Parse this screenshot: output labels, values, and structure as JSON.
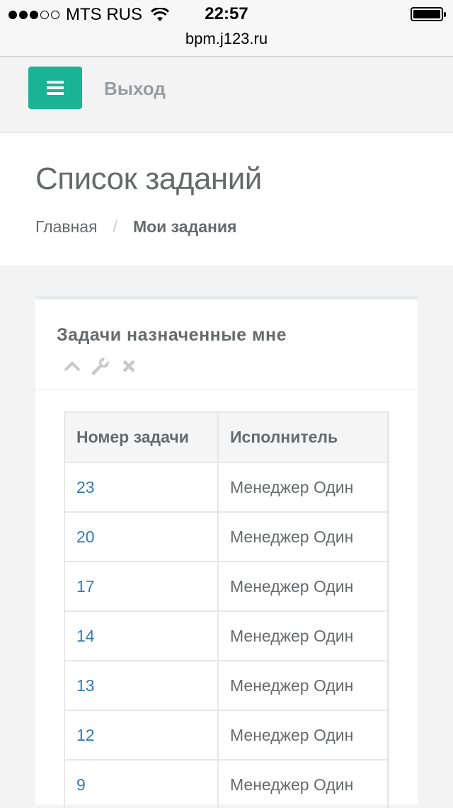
{
  "status_bar": {
    "carrier": "MTS RUS",
    "time": "22:57",
    "signal_bars_filled": 3,
    "signal_bars_total": 5,
    "battery_level": 1.0,
    "url": "bpm.j123.ru"
  },
  "navbar": {
    "menu_icon": "hamburger-icon",
    "logout_label": "Выход",
    "accent_color": "#1ab394"
  },
  "heading": {
    "title": "Список заданий",
    "breadcrumb": {
      "home": "Главная",
      "separator": "/",
      "current": "Мои задания"
    }
  },
  "ibox": {
    "title": "Задачи назначенные мне",
    "tools": [
      "chevron-up-icon",
      "wrench-icon",
      "close-icon"
    ],
    "table": {
      "headers": [
        "Номер задачи",
        "Исполнитель"
      ],
      "rows": [
        {
          "number": "23",
          "assignee": "Менеджер Один"
        },
        {
          "number": "20",
          "assignee": "Менеджер Один"
        },
        {
          "number": "17",
          "assignee": "Менеджер Один"
        },
        {
          "number": "14",
          "assignee": "Менеджер Один"
        },
        {
          "number": "13",
          "assignee": "Менеджер Один"
        },
        {
          "number": "12",
          "assignee": "Менеджер Один"
        },
        {
          "number": "9",
          "assignee": "Менеджер Один"
        }
      ]
    }
  }
}
